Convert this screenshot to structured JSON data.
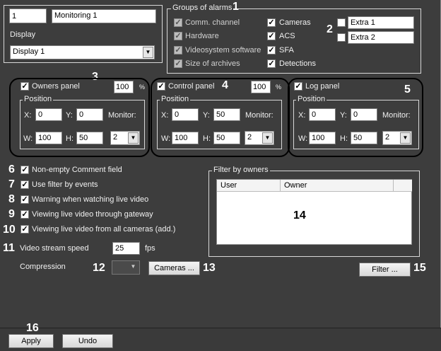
{
  "top": {
    "id_value": "1",
    "name_value": "Monitoring 1",
    "display_label": "Display",
    "display_value": "Display 1"
  },
  "groups": {
    "legend": "Groups of alarms",
    "items": [
      {
        "label": "Comm. channel",
        "checked": true,
        "disabled": true
      },
      {
        "label": "Hardware",
        "checked": true,
        "disabled": true
      },
      {
        "label": "Videosystem software",
        "checked": true,
        "disabled": true
      },
      {
        "label": "Size of archives",
        "checked": true,
        "disabled": true
      },
      {
        "label": "Cameras",
        "checked": true,
        "disabled": false
      },
      {
        "label": "ACS",
        "checked": true,
        "disabled": false
      },
      {
        "label": "SFA",
        "checked": true,
        "disabled": false
      },
      {
        "label": "Detections",
        "checked": true,
        "disabled": false
      }
    ],
    "extra": [
      {
        "value": "Extra 1",
        "checked": false
      },
      {
        "value": "Extra 2",
        "checked": false
      }
    ]
  },
  "panels": [
    {
      "label": "Owners panel",
      "percent": "100",
      "unit": "%",
      "position_legend": "Position",
      "x_label": "X:",
      "x": "0",
      "y_label": "Y:",
      "y": "0",
      "monitor_label": "Monitor:",
      "w_label": "W:",
      "w": "100",
      "h_label": "H:",
      "h": "50",
      "monitor": "2"
    },
    {
      "label": "Control panel",
      "percent": "100",
      "unit": "%",
      "position_legend": "Position",
      "x_label": "X:",
      "x": "0",
      "y_label": "Y:",
      "y": "50",
      "monitor_label": "Monitor:",
      "w_label": "W:",
      "w": "100",
      "h_label": "H:",
      "h": "50",
      "monitor": "2"
    },
    {
      "label": "Log panel",
      "position_legend": "Position",
      "x_label": "X:",
      "x": "0",
      "y_label": "Y:",
      "y": "0",
      "monitor_label": "Monitor:",
      "w_label": "W:",
      "w": "100",
      "h_label": "H:",
      "h": "50",
      "monitor": "2"
    }
  ],
  "options": [
    {
      "label": "Non-empty Comment field",
      "checked": true
    },
    {
      "label": "Use filter by events",
      "checked": true
    },
    {
      "label": "Warning when watching live video",
      "checked": true
    },
    {
      "label": "Viewing live video through gateway",
      "checked": true
    },
    {
      "label": "Viewing live video from all cameras (add.)",
      "checked": true
    }
  ],
  "stream": {
    "label": "Video stream speed",
    "value": "25",
    "unit": "fps"
  },
  "compression": {
    "label": "Compression",
    "value": ""
  },
  "cameras_button": "Cameras ...",
  "filter_owners": {
    "legend": "Filter by owners",
    "columns": [
      "User",
      "Owner"
    ]
  },
  "filter_button": "Filter ...",
  "bottom": {
    "apply": "Apply",
    "undo": "Undo"
  },
  "callouts": [
    "1",
    "2",
    "3",
    "4",
    "5",
    "6",
    "7",
    "8",
    "9",
    "10",
    "11",
    "12",
    "13",
    "14",
    "15",
    "16"
  ]
}
